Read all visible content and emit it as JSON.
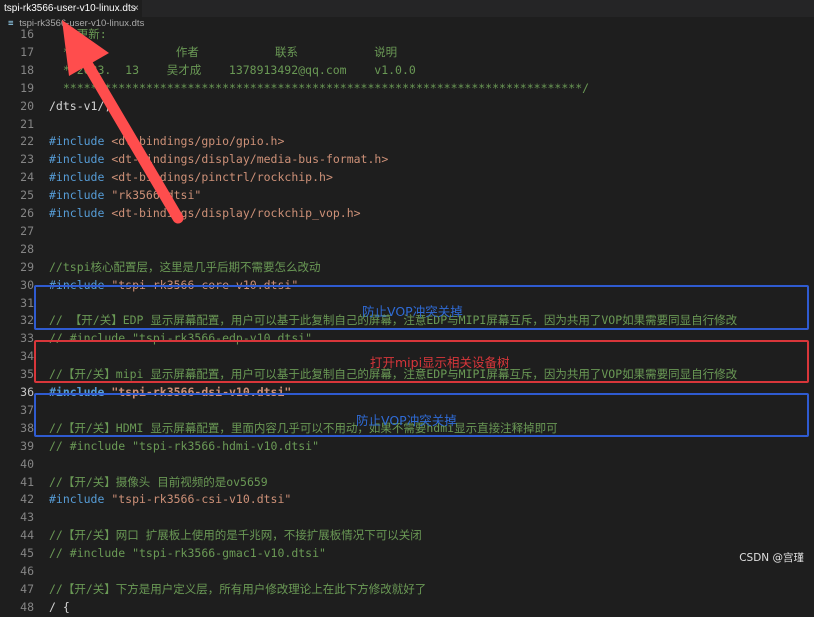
{
  "tab": {
    "title": "tspi-rk3566-user-v10-linux.dts",
    "close": "×"
  },
  "breadcrumb": {
    "icon": "≡",
    "label": "tspi-rk3566-user-v10-linux.dts"
  },
  "editor": {
    "lines": [
      {
        "num": "16",
        "segs": [
          {
            "t": "  * 更新:",
            "c": "c-cmt"
          }
        ]
      },
      {
        "num": "17",
        "segs": [
          {
            "t": "  * 时间           作者           联系           说明",
            "c": "c-cmt"
          }
        ]
      },
      {
        "num": "18",
        "segs": [
          {
            "t": "  * 2023.  13    吴才成    1378913492@qq.com    v1.0.0",
            "c": "c-cmt"
          }
        ]
      },
      {
        "num": "19",
        "segs": [
          {
            "t": "  ***************************************************************************/",
            "c": "c-cmt"
          }
        ]
      },
      {
        "num": "20",
        "segs": [
          {
            "t": "/dts-v1/;",
            "c": ""
          }
        ]
      },
      {
        "num": "21",
        "segs": []
      },
      {
        "num": "22",
        "segs": [
          {
            "t": "#include ",
            "c": "c-kw"
          },
          {
            "t": "<dt-bindings/gpio/gpio.h>",
            "c": "c-str"
          }
        ]
      },
      {
        "num": "23",
        "segs": [
          {
            "t": "#include ",
            "c": "c-kw"
          },
          {
            "t": "<dt-bindings/display/media-bus-format.h>",
            "c": "c-str"
          }
        ]
      },
      {
        "num": "24",
        "segs": [
          {
            "t": "#include ",
            "c": "c-kw"
          },
          {
            "t": "<dt-bindings/pinctrl/rockchip.h>",
            "c": "c-str"
          }
        ]
      },
      {
        "num": "25",
        "segs": [
          {
            "t": "#include ",
            "c": "c-kw"
          },
          {
            "t": "\"rk3566.dtsi\"",
            "c": "c-str"
          }
        ]
      },
      {
        "num": "26",
        "segs": [
          {
            "t": "#include ",
            "c": "c-kw"
          },
          {
            "t": "<dt-bindings/display/rockchip_vop.h>",
            "c": "c-str"
          }
        ]
      },
      {
        "num": "27",
        "segs": []
      },
      {
        "num": "28",
        "segs": []
      },
      {
        "num": "29",
        "segs": [
          {
            "t": "//tspi核心配置层，这里是几乎后期不需要怎么改动",
            "c": "c-cmt"
          }
        ]
      },
      {
        "num": "30",
        "segs": [
          {
            "t": "#include ",
            "c": "c-kw"
          },
          {
            "t": "\"tspi-rk3566-core-v10.dtsi\"",
            "c": "c-str"
          }
        ]
      },
      {
        "num": "31",
        "segs": []
      },
      {
        "num": "32",
        "segs": [
          {
            "t": "// 【开/关】EDP 显示屏幕配置，用户可以基于此复制自己的屏幕，注意EDP与MIPI屏幕互斥，因为共用了VOP如果需要同显自行修改",
            "c": "c-cmt"
          }
        ]
      },
      {
        "num": "33",
        "segs": [
          {
            "t": "// #include \"tspi-rk3566-edp-v10.dtsi\"",
            "c": "c-cmt"
          }
        ]
      },
      {
        "num": "34",
        "segs": []
      },
      {
        "num": "35",
        "segs": [
          {
            "t": "//【开/关】mipi 显示屏幕配置，用户可以基于此复制自己的屏幕，注意EDP与MIPI屏幕互斥，因为共用了VOP如果需要同显自行修改",
            "c": "c-cmt"
          }
        ]
      },
      {
        "num": "36",
        "active": true,
        "segs": [
          {
            "t": "#include ",
            "c": "c-kw c-bold"
          },
          {
            "t": "\"tspi-rk3566-dsi-v10.dtsi\"",
            "c": "c-str c-bold"
          }
        ]
      },
      {
        "num": "37",
        "segs": []
      },
      {
        "num": "38",
        "segs": [
          {
            "t": "//【开/关】HDMI 显示屏幕配置，里面内容几乎可以不用动，如果不需要hdmi显示直接注释掉即可",
            "c": "c-cmt"
          }
        ]
      },
      {
        "num": "39",
        "segs": [
          {
            "t": "// #include \"tspi-rk3566-hdmi-v10.dtsi\"",
            "c": "c-cmt"
          }
        ]
      },
      {
        "num": "40",
        "segs": []
      },
      {
        "num": "41",
        "segs": [
          {
            "t": "//【开/关】摄像头 目前视频的是ov5659",
            "c": "c-cmt"
          }
        ]
      },
      {
        "num": "42",
        "segs": [
          {
            "t": "#include ",
            "c": "c-kw"
          },
          {
            "t": "\"tspi-rk3566-csi-v10.dtsi\"",
            "c": "c-str"
          }
        ]
      },
      {
        "num": "43",
        "segs": []
      },
      {
        "num": "44",
        "segs": [
          {
            "t": "//【开/关】网口 扩展板上使用的是千兆网，不接扩展板情况下可以关闭",
            "c": "c-cmt"
          }
        ]
      },
      {
        "num": "45",
        "segs": [
          {
            "t": "// #include \"tspi-rk3566-gmac1-v10.dtsi\"",
            "c": "c-cmt"
          }
        ]
      },
      {
        "num": "46",
        "segs": []
      },
      {
        "num": "47",
        "segs": [
          {
            "t": "//【开/关】下方是用户定义层，所有用户修改理论上在此下方修改就好了",
            "c": "c-cmt"
          }
        ]
      },
      {
        "num": "48",
        "segs": [
          {
            "t": "/ {",
            "c": ""
          }
        ]
      }
    ]
  },
  "annotations": {
    "edp_note": "防止VOP冲突关掉",
    "mipi_note": "打开mipi显示相关设备树",
    "hdmi_note": "防止VOP冲突关掉"
  },
  "colors": {
    "blue_box": "#2f5bd0",
    "red_box": "#d8363a",
    "arrow": "#ff4d4d"
  },
  "watermark": "CSDN @宫瑾"
}
